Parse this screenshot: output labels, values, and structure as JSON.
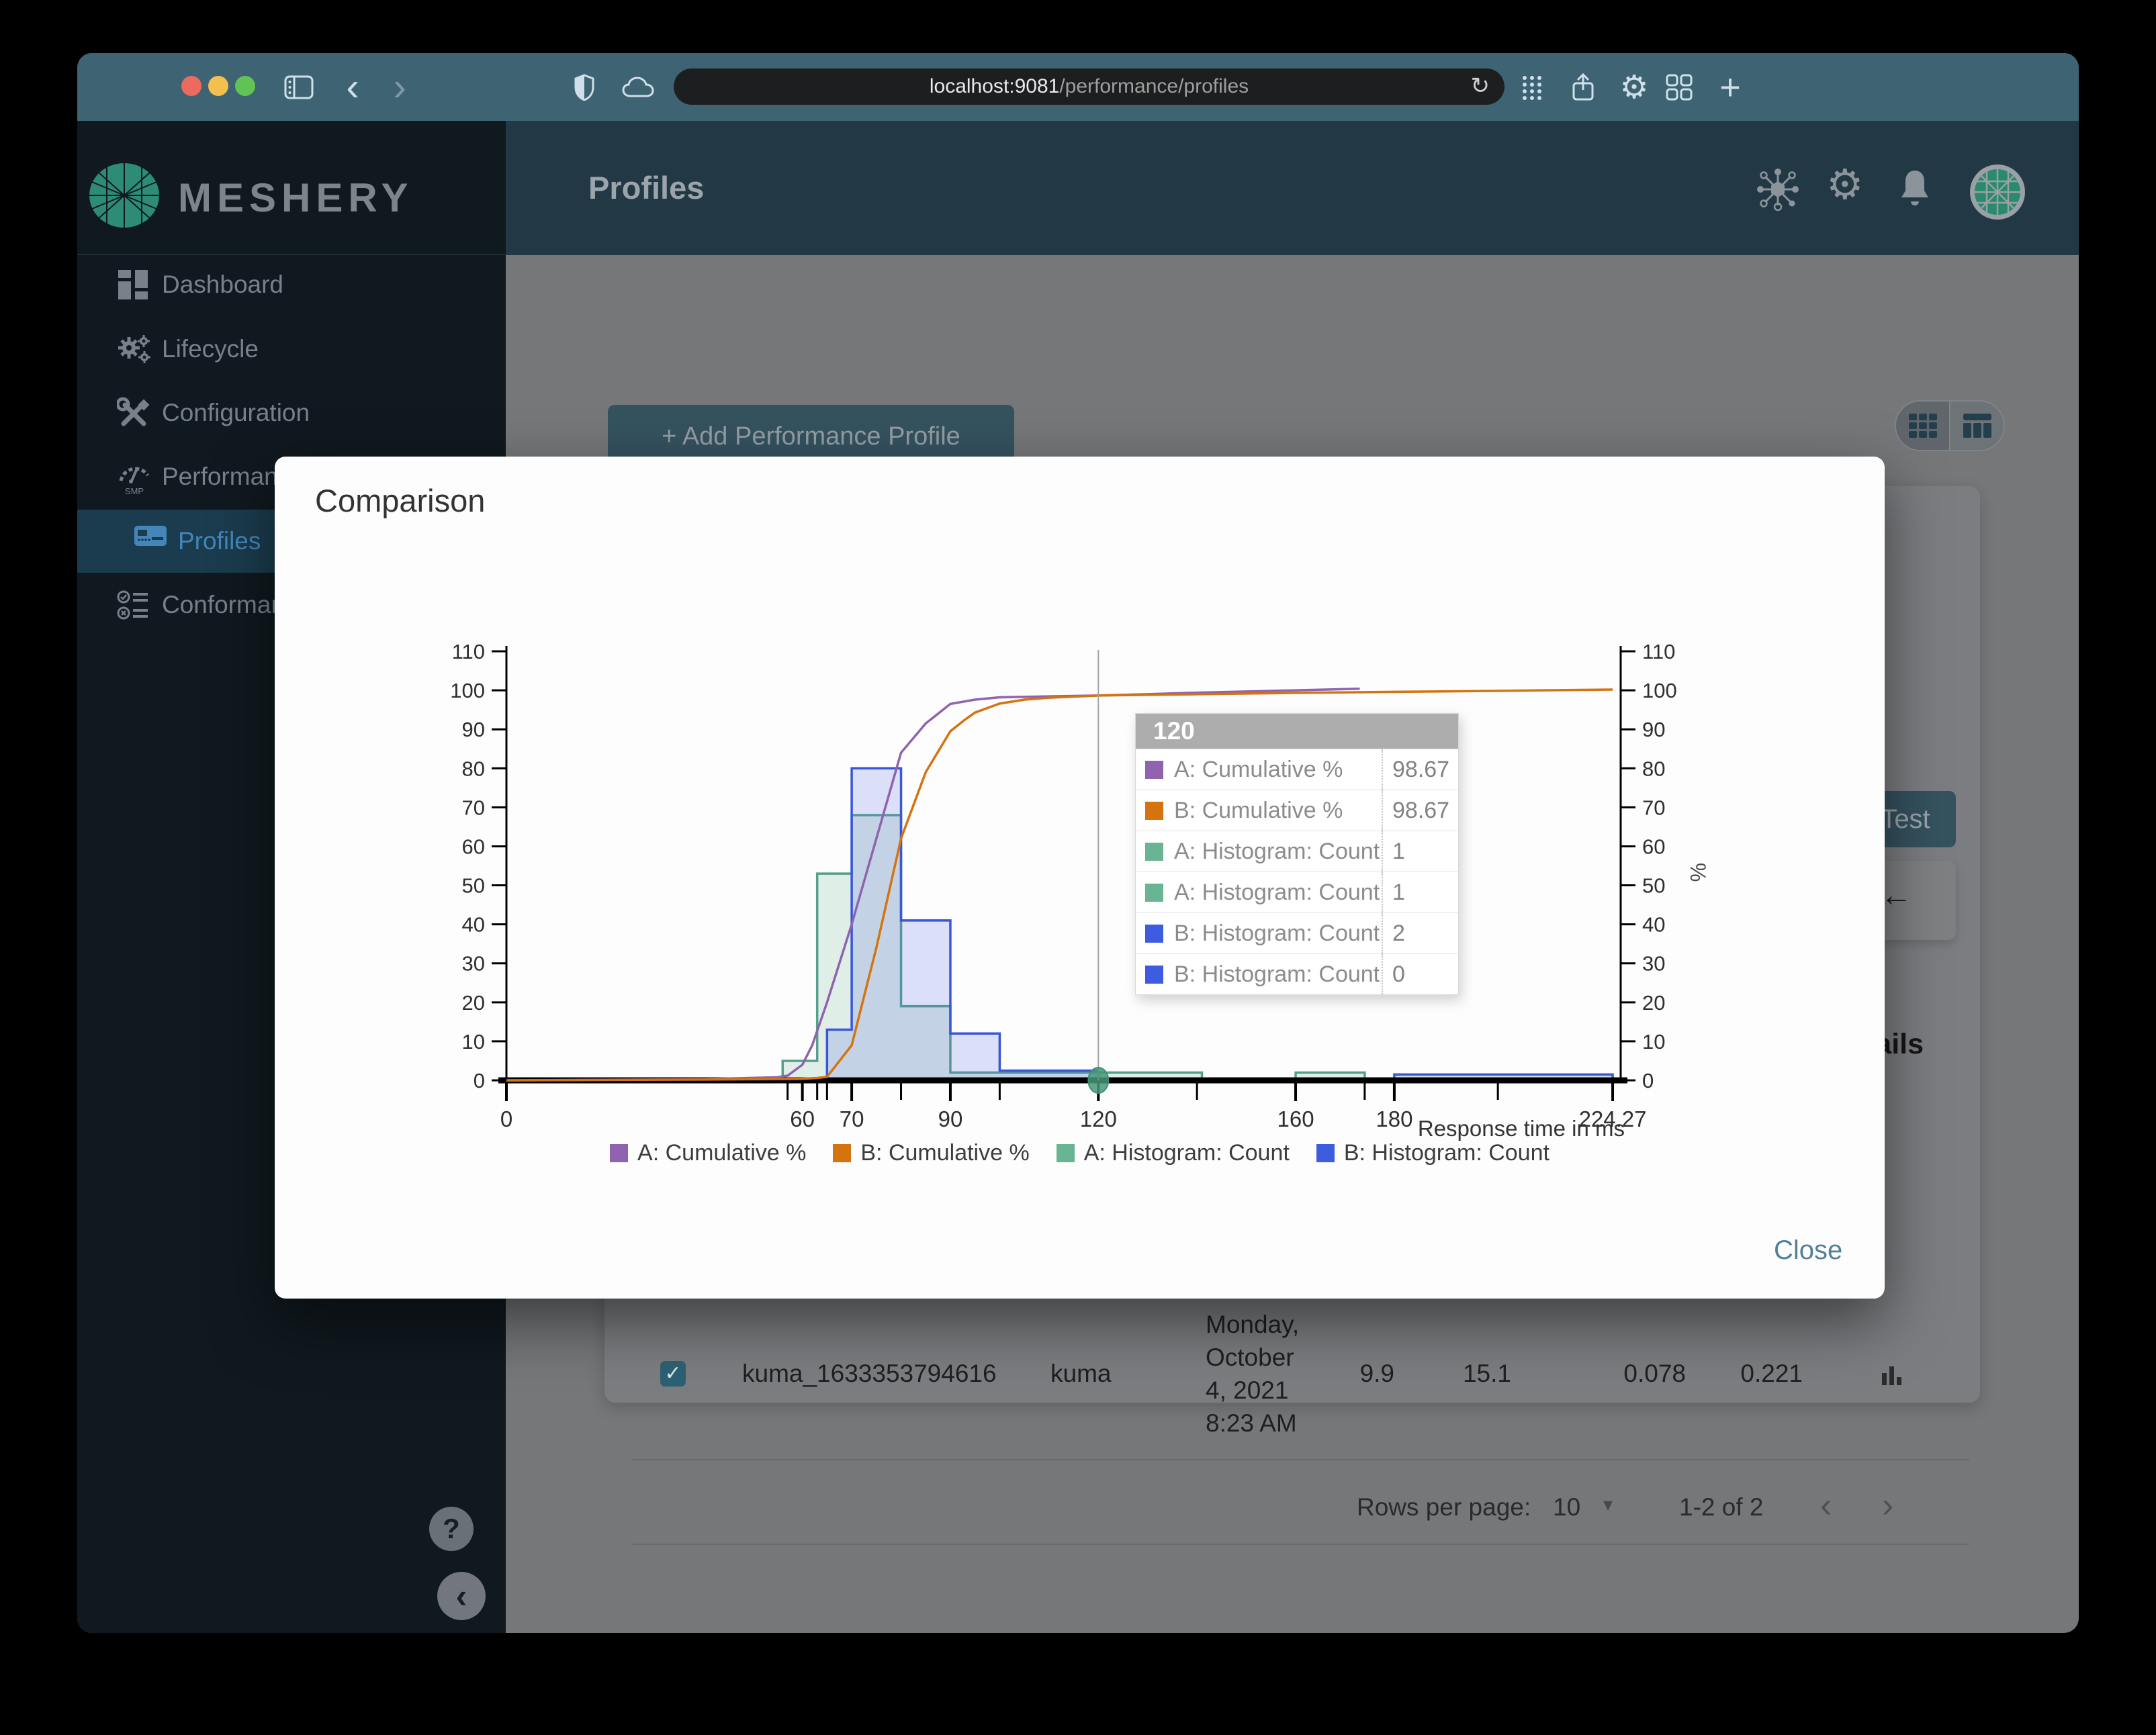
{
  "browser": {
    "url": {
      "host": "localhost:9081",
      "path": "/performance/profiles"
    },
    "reload_glyph": "↻",
    "back_glyph": "‹",
    "forward_glyph": "›",
    "plus_glyph": "+"
  },
  "sidebar": {
    "brand": "MESHERY",
    "items": [
      {
        "label": "Dashboard",
        "icon": "dashboard-icon",
        "selected": false,
        "sub": false
      },
      {
        "label": "Lifecycle",
        "icon": "lifecycle-icon",
        "selected": false,
        "sub": false
      },
      {
        "label": "Configuration",
        "icon": "configuration-icon",
        "selected": false,
        "sub": false
      },
      {
        "label": "Performance",
        "icon": "performance-icon",
        "selected": false,
        "sub": false
      },
      {
        "label": "Profiles",
        "icon": "profiles-icon",
        "selected": true,
        "sub": true
      },
      {
        "label": "Conformance",
        "icon": "conformance-icon",
        "selected": false,
        "sub": false
      }
    ],
    "performance_icon_text": "SMP",
    "help_glyph": "?",
    "collapse_glyph": "‹"
  },
  "header": {
    "title": "Profiles"
  },
  "content": {
    "add_profile_button": "+ Add Performance Profile",
    "profile_card": {
      "test_button": "Test",
      "details_heading": "Details",
      "back_arrow": "←"
    },
    "results_table": {
      "row": {
        "name": "kuma_1633353794616",
        "mesh": "kuma",
        "date_lines": [
          "Monday,",
          "October",
          "4, 2021",
          "8:23 AM"
        ],
        "qps": "9.9",
        "duration": "15.1",
        "p50": "0.078",
        "p99": "0.221",
        "checkbox_checked": true,
        "check_glyph": "✓"
      }
    },
    "pagination": {
      "label": "Rows per page:",
      "value": "10",
      "caret": "▾",
      "range": "1-2 of 2",
      "prev": "‹",
      "next": "›"
    }
  },
  "modal": {
    "title": "Comparison",
    "close": "Close"
  },
  "colors": {
    "checkbox_teal": "#2c6173",
    "close_link": "#54809b",
    "selected_nav": "#4286ba",
    "traffic_red": "#ec6a5e",
    "traffic_yellow": "#f5bf4f",
    "traffic_green": "#61c354",
    "meshery_green": "#2e8b74"
  },
  "chart_data": {
    "type": "line+histogram",
    "xlabel": "Response time in ms",
    "ylabel_right": "%",
    "ylim": [
      0,
      110
    ],
    "ytick_step": 10,
    "xlim": [
      0,
      226
    ],
    "x_major_ticks": [
      {
        "v": 0,
        "label": "0"
      },
      {
        "v": 60,
        "label": "60"
      },
      {
        "v": 70,
        "label": "70"
      },
      {
        "v": 90,
        "label": "90"
      },
      {
        "v": 120,
        "label": "120"
      },
      {
        "v": 160,
        "label": "160"
      },
      {
        "v": 180,
        "label": "180"
      },
      {
        "v": 224.27,
        "label": "224.27"
      }
    ],
    "x_minor_ticks": [
      57,
      63,
      65,
      80,
      100,
      140,
      174,
      201
    ],
    "series": [
      {
        "name": "A: Cumulative %",
        "type": "line",
        "color": "#8f63ad",
        "points": [
          [
            0,
            0
          ],
          [
            40,
            0.3
          ],
          [
            55,
            0.8
          ],
          [
            57,
            1.2
          ],
          [
            60,
            4
          ],
          [
            62,
            9
          ],
          [
            65,
            20
          ],
          [
            70,
            40
          ],
          [
            75,
            62
          ],
          [
            80,
            84
          ],
          [
            85,
            91.5
          ],
          [
            90,
            96.5
          ],
          [
            95,
            97.6
          ],
          [
            100,
            98.2
          ],
          [
            110,
            98.45
          ],
          [
            120,
            98.67
          ],
          [
            130,
            99
          ],
          [
            140,
            99.4
          ],
          [
            150,
            99.7
          ],
          [
            160,
            100
          ],
          [
            173,
            100.4
          ]
        ]
      },
      {
        "name": "B: Cumulative %",
        "type": "line",
        "color": "#d4730f",
        "points": [
          [
            0,
            0
          ],
          [
            40,
            0.2
          ],
          [
            60,
            0.4
          ],
          [
            63,
            0.6
          ],
          [
            65,
            0.9
          ],
          [
            70,
            9
          ],
          [
            75,
            34
          ],
          [
            80,
            62
          ],
          [
            85,
            79
          ],
          [
            90,
            89.5
          ],
          [
            93,
            92.5
          ],
          [
            95,
            94.3
          ],
          [
            100,
            96.6
          ],
          [
            105,
            97.6
          ],
          [
            110,
            98.1
          ],
          [
            120,
            98.67
          ],
          [
            140,
            99
          ],
          [
            160,
            99.35
          ],
          [
            180,
            99.6
          ],
          [
            200,
            99.85
          ],
          [
            224.27,
            100.2
          ]
        ]
      },
      {
        "name": "A: Histogram: Count",
        "type": "histogram",
        "color": "#68b493",
        "stroke": "#55a08c",
        "fill": "rgba(105,180,147,0.20)",
        "bins": [
          [
            56,
            63,
            5
          ],
          [
            63,
            70,
            53
          ],
          [
            70,
            80,
            68
          ],
          [
            80,
            90,
            19
          ],
          [
            90,
            141,
            2
          ],
          [
            160,
            174,
            2
          ]
        ]
      },
      {
        "name": "B: Histogram: Count",
        "type": "histogram",
        "color": "#3e5cdf",
        "stroke": "#3a57d7",
        "fill": "rgba(85,105,225,0.20)",
        "bins": [
          [
            65,
            70,
            13
          ],
          [
            70,
            80,
            80
          ],
          [
            80,
            90,
            41
          ],
          [
            90,
            100,
            12
          ],
          [
            100,
            120,
            2.5
          ],
          [
            180,
            224.27,
            1.5
          ]
        ]
      }
    ],
    "legend": [
      {
        "label": "A: Cumulative %",
        "color": "#8f63ad"
      },
      {
        "label": "B: Cumulative %",
        "color": "#d4730f"
      },
      {
        "label": "A: Histogram: Count",
        "color": "#68b493"
      },
      {
        "label": "B: Histogram: Count",
        "color": "#3e5cdf"
      }
    ],
    "hover": {
      "x": 120,
      "title": "120",
      "rows": [
        {
          "color": "#8f63ad",
          "label": "A: Cumulative %",
          "value": "98.67"
        },
        {
          "color": "#d4730f",
          "label": "B: Cumulative %",
          "value": "98.67"
        },
        {
          "color": "#68b493",
          "label": "A: Histogram: Count",
          "value": "1"
        },
        {
          "color": "#68b493",
          "label": "A: Histogram: Count",
          "value": "1"
        },
        {
          "color": "#3e5cdf",
          "label": "B: Histogram: Count",
          "value": "2"
        },
        {
          "color": "#3e5cdf",
          "label": "B: Histogram: Count",
          "value": "0"
        }
      ]
    }
  }
}
